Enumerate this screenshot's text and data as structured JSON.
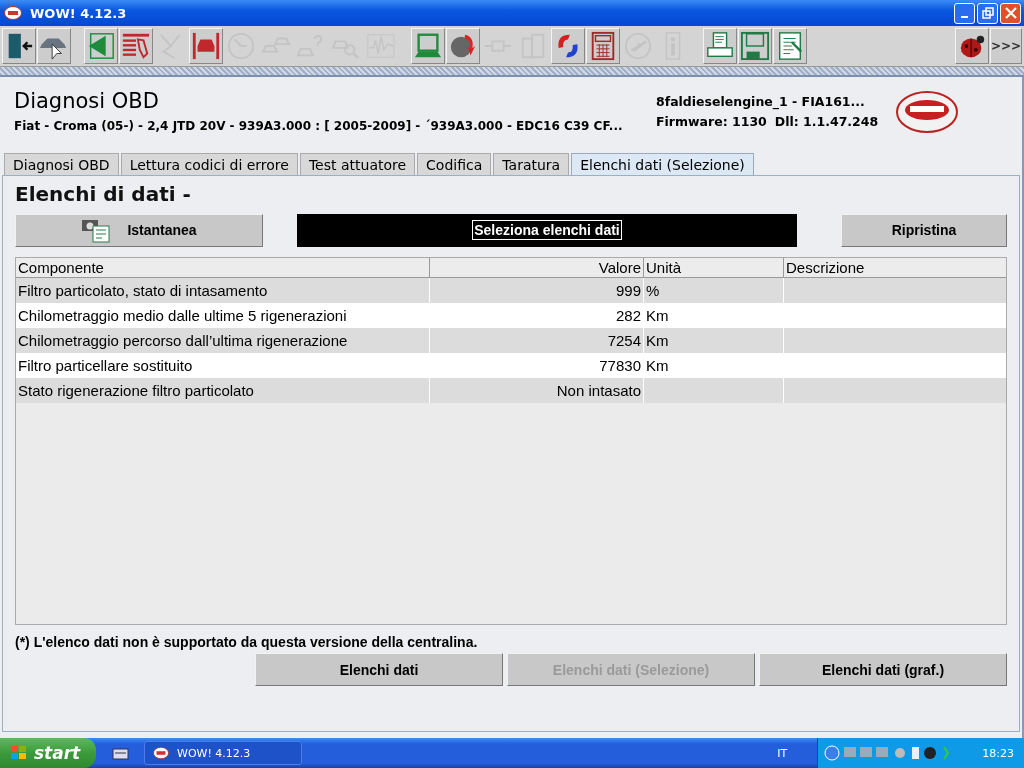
{
  "window": {
    "title": "WOW! 4.12.3"
  },
  "toolbar": {
    "buttons": [
      {
        "kind": "door",
        "disabled": false
      },
      {
        "kind": "car",
        "disabled": false
      },
      {
        "kind": "back",
        "disabled": false
      },
      {
        "kind": "list",
        "disabled": false
      },
      {
        "kind": "route",
        "disabled": true
      },
      {
        "kind": "lift",
        "disabled": false
      },
      {
        "kind": "clock",
        "disabled": true
      },
      {
        "kind": "cars",
        "disabled": true
      },
      {
        "kind": "car-question",
        "disabled": true
      },
      {
        "kind": "car-search",
        "disabled": true
      },
      {
        "kind": "graph",
        "disabled": true
      },
      {
        "kind": "laptop",
        "disabled": false
      },
      {
        "kind": "globe",
        "disabled": false
      },
      {
        "kind": "plug",
        "disabled": true
      },
      {
        "kind": "boxes",
        "disabled": true
      },
      {
        "kind": "sync",
        "disabled": false
      },
      {
        "kind": "calculator",
        "disabled": false
      },
      {
        "kind": "plane",
        "disabled": true
      },
      {
        "kind": "info",
        "disabled": true
      },
      {
        "kind": "printer",
        "disabled": false
      },
      {
        "kind": "floppy",
        "disabled": false
      },
      {
        "kind": "document",
        "disabled": false
      }
    ],
    "more": ">>>"
  },
  "header": {
    "title": "Diagnosi OBD",
    "vehicle": "Fiat - Croma (05-) - 2,4 JTD 20V - 939A3.000 : [ 2005-2009] - ´939A3.000 - EDC16 C39 CF...",
    "device": "8faldieselengine_1 - FIA161...",
    "firmware": "Firmware: 1130",
    "dll": "Dll: 1.1.47.248"
  },
  "tabs": [
    {
      "label": "Diagnosi OBD",
      "selected": false
    },
    {
      "label": "Lettura codici di errore",
      "selected": false
    },
    {
      "label": "Test attuatore",
      "selected": false
    },
    {
      "label": "Codifica",
      "selected": false
    },
    {
      "label": "Taratura",
      "selected": false
    },
    {
      "label": "Elenchi dati (Selezione)",
      "selected": true
    }
  ],
  "section_title": "Elenchi di dati -",
  "actions": {
    "snapshot": "Istantanea",
    "select": "Seleziona elenchi dati",
    "reset": "Ripristina"
  },
  "table": {
    "columns": [
      "Componente",
      "Valore",
      "Unità",
      "Descrizione"
    ],
    "rows": [
      [
        "Filtro particolato, stato di intasamento",
        "999",
        "%",
        ""
      ],
      [
        "Chilometraggio medio dalle ultime 5 rigenerazioni",
        "282",
        "Km",
        ""
      ],
      [
        "Chilometraggio percorso dall’ultima rigenerazione",
        "7254",
        "Km",
        ""
      ],
      [
        "Filtro particellare sostituito",
        "77830",
        "Km",
        ""
      ],
      [
        "Stato rigenerazione filtro particolato",
        "Non intasato",
        "",
        ""
      ]
    ]
  },
  "footnote": "(*) L'elenco dati non è supportato da questa versione della centralina.",
  "bottom_buttons": [
    {
      "label": "Elenchi dati",
      "disabled": false
    },
    {
      "label": "Elenchi dati (Selezione)",
      "disabled": true
    },
    {
      "label": "Elenchi dati (graf.)",
      "disabled": false
    }
  ],
  "taskbar": {
    "start": "start",
    "tasks": [
      {
        "label": "WOW! 4.12.3"
      }
    ],
    "language": "IT",
    "clock": "18:23"
  }
}
